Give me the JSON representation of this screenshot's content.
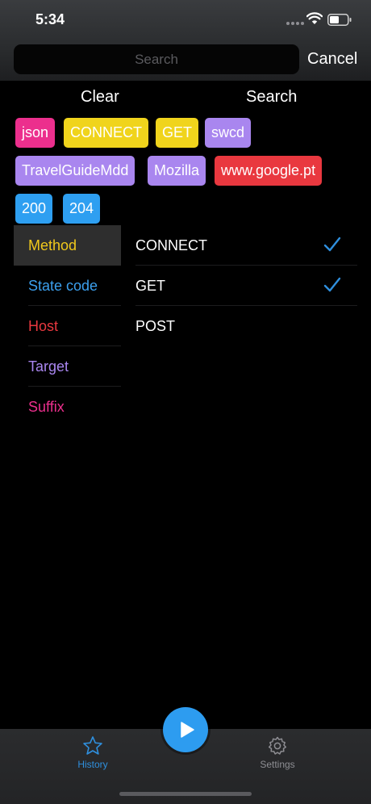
{
  "status_bar": {
    "time": "5:34"
  },
  "search": {
    "placeholder": "Search",
    "value": "",
    "cancel_label": "Cancel"
  },
  "actions": {
    "clear_label": "Clear",
    "search_label": "Search"
  },
  "colors": {
    "pink": "#ec2f8d",
    "yellow": "#f0d41c",
    "purple": "#a986ef",
    "red": "#e9383f",
    "blue": "#2e9ff1",
    "accent_blue": "#2f8fdd"
  },
  "chips": [
    {
      "label": "json",
      "color": "#ec2f8d"
    },
    {
      "label": "CONNECT",
      "color": "#f0d41c"
    },
    {
      "label": "GET",
      "color": "#f0d41c"
    },
    {
      "label": "swcd",
      "color": "#a986ef"
    },
    {
      "label": "TravelGuideMdd",
      "color": "#a986ef"
    },
    {
      "label": "Mozilla",
      "color": "#a986ef"
    },
    {
      "label": "www.google.pt",
      "color": "#e9383f"
    },
    {
      "label": "200",
      "color": "#2e9ff1"
    },
    {
      "label": "204",
      "color": "#2e9ff1"
    }
  ],
  "categories": [
    {
      "label": "Method",
      "color": "#f0c81c",
      "active": true
    },
    {
      "label": "State code",
      "color": "#3ca0ee",
      "active": false
    },
    {
      "label": "Host",
      "color": "#e9383f",
      "active": false
    },
    {
      "label": "Target",
      "color": "#a986ef",
      "active": false
    },
    {
      "label": "Suffix",
      "color": "#ec2f8d",
      "active": false
    }
  ],
  "options": [
    {
      "label": "CONNECT",
      "checked": true
    },
    {
      "label": "GET",
      "checked": true
    },
    {
      "label": "POST",
      "checked": false
    }
  ],
  "tabs": [
    {
      "label": "History",
      "icon": "star-icon",
      "active": true
    },
    {
      "label": "Settings",
      "icon": "gear-icon",
      "active": false
    }
  ],
  "play_button": {
    "icon": "play-icon"
  }
}
